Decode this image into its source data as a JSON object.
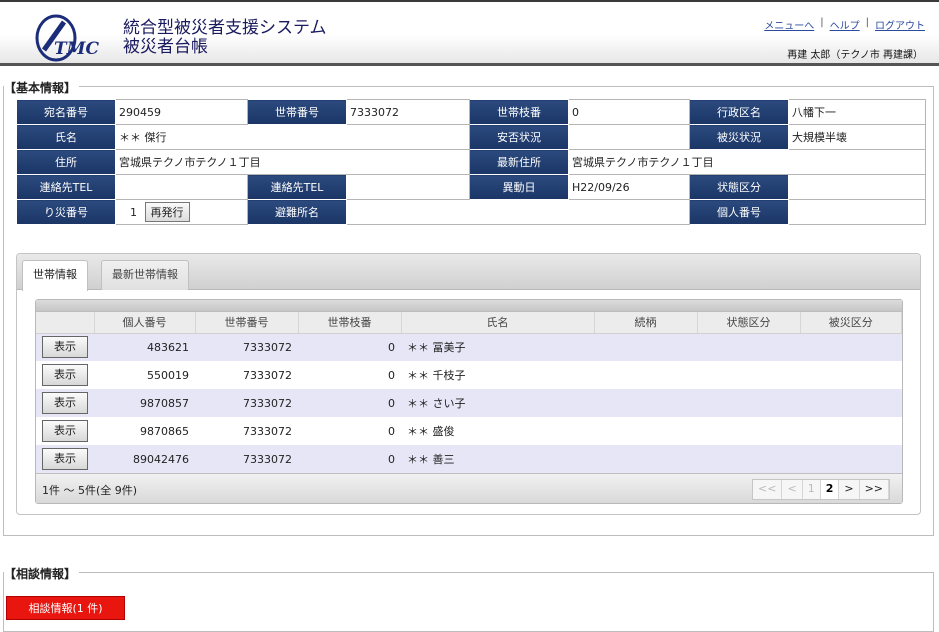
{
  "header": {
    "system_title": "統合型被災者支援システム",
    "page_title": "被災者台帳",
    "logo_text": "TMC",
    "links": [
      "メニューへ",
      "ヘルプ",
      "ログアウト"
    ],
    "user_info": "再建 太郎（テクノ市 再建課）"
  },
  "basic_info": {
    "legend": "【基本情報】",
    "labels": {
      "address_no": "宛名番号",
      "household_no": "世帯番号",
      "household_branch": "世帯枝番",
      "district": "行政区名",
      "name": "氏名",
      "safety": "安否状況",
      "damage": "被災状況",
      "address": "住所",
      "latest_address": "最新住所",
      "contact_tel1": "連絡先TEL",
      "contact_tel2": "連絡先TEL",
      "move_date": "異動日",
      "status": "状態区分",
      "disaster_no": "り災番号",
      "shelter": "避難所名",
      "personal_no": "個人番号"
    },
    "values": {
      "address_no": "290459",
      "household_no": "7333072",
      "household_branch": "0",
      "district": "八幡下一",
      "name": "＊＊ 傑行",
      "safety": "",
      "damage": "大規模半壊",
      "address": "宮城県テクノ市テクノ１丁目",
      "latest_address": "宮城県テクノ市テクノ１丁目",
      "contact_tel1": "",
      "contact_tel2": "",
      "move_date": "H22/09/26",
      "status": "",
      "disaster_no": "1",
      "shelter": "",
      "personal_no": ""
    },
    "reissue_label": "再発行"
  },
  "tabs": [
    {
      "label": "世帯情報",
      "active": true
    },
    {
      "label": "最新世帯情報",
      "active": false
    }
  ],
  "members_table": {
    "columns": [
      "",
      "個人番号",
      "世帯番号",
      "世帯枝番",
      "氏名",
      "続柄",
      "状態区分",
      "被災区分"
    ],
    "button_label": "表示",
    "rows": [
      {
        "personal_no": "483621",
        "household_no": "7333072",
        "branch": "0",
        "name": "＊＊ 冨美子",
        "relation": "",
        "status": "",
        "damage": ""
      },
      {
        "personal_no": "550019",
        "household_no": "7333072",
        "branch": "0",
        "name": "＊＊ 千枝子",
        "relation": "",
        "status": "",
        "damage": ""
      },
      {
        "personal_no": "9870857",
        "household_no": "7333072",
        "branch": "0",
        "name": "＊＊ さい子",
        "relation": "",
        "status": "",
        "damage": ""
      },
      {
        "personal_no": "9870865",
        "household_no": "7333072",
        "branch": "0",
        "name": "＊＊ 盛俊",
        "relation": "",
        "status": "",
        "damage": ""
      },
      {
        "personal_no": "89042476",
        "household_no": "7333072",
        "branch": "0",
        "name": "＊＊ 善三",
        "relation": "",
        "status": "",
        "damage": ""
      }
    ],
    "count_text": "1件 〜 5件(全 9件)",
    "pager": [
      "<<",
      "<",
      "1",
      "2",
      ">",
      ">>"
    ],
    "current_page": "2"
  },
  "consult": {
    "legend": "【相談情報】",
    "button_label": "相談情報(1 件)",
    "button_color": "#e8160f"
  }
}
